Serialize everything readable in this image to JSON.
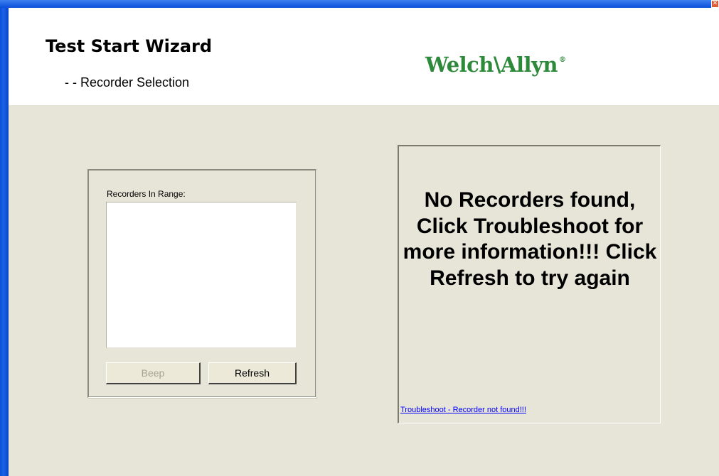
{
  "window": {
    "close_glyph": "✕"
  },
  "header": {
    "title": "Test Start Wizard",
    "subtitle": "- - Recorder Selection",
    "logo": {
      "text_left": "Welch",
      "separator": "\\",
      "text_right": "Allyn",
      "registered_mark": "®",
      "color": "#2d8a3a"
    }
  },
  "recorders": {
    "label": "Recorders In Range:",
    "items": [],
    "beep_label": "Beep",
    "refresh_label": "Refresh"
  },
  "message": {
    "text": "No Recorders found, Click Troubleshoot for more information!!! Click Refresh to try again",
    "link": "Troubleshoot - Recorder not found!!!"
  },
  "colors": {
    "background": "#E7E5D8",
    "header_background": "#ffffff",
    "link": "#0000ff",
    "disabled_text": "#a4a290"
  }
}
